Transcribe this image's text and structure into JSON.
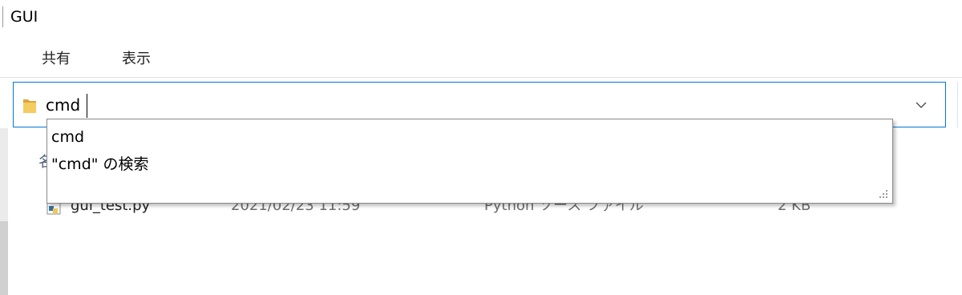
{
  "window": {
    "title": "GUI"
  },
  "ribbon": {
    "tabs": [
      {
        "label": "共有"
      },
      {
        "label": "表示"
      }
    ]
  },
  "address_bar": {
    "value": "cmd",
    "icon": "folder-icon",
    "dropdown_icon": "chevron-down-icon"
  },
  "file_list": {
    "header_fragment": "名",
    "rows": [
      {
        "name": "gui_test.py",
        "date_modified": "2021/02/23 11:59",
        "type": "Python ソース ファイル",
        "size": "2 KB",
        "icon": "python-file-icon"
      }
    ]
  },
  "suggestions": {
    "items": [
      {
        "label": "cmd"
      },
      {
        "label": "\"cmd\" の検索"
      }
    ]
  },
  "colors": {
    "address_border": "#0078d7",
    "folder_yellow": "#e8b84a",
    "text_secondary": "#6d6d6d"
  }
}
